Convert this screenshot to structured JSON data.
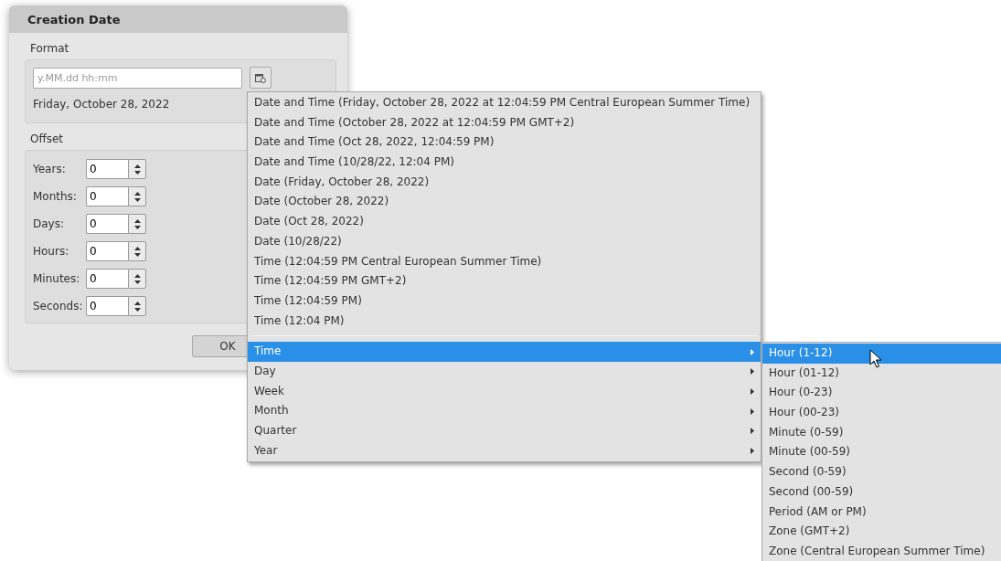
{
  "dialog": {
    "title": "Creation Date",
    "format": {
      "label": "Format",
      "placeholder": "y.MM.dd hh:mm",
      "preview": "Friday, October 28, 2022"
    },
    "offset": {
      "label": "Offset",
      "fields": [
        {
          "label": "Years:",
          "value": "0"
        },
        {
          "label": "Months:",
          "value": "0"
        },
        {
          "label": "Days:",
          "value": "0"
        },
        {
          "label": "Hours:",
          "value": "0"
        },
        {
          "label": "Minutes:",
          "value": "0"
        },
        {
          "label": "Seconds:",
          "value": "0"
        }
      ]
    },
    "buttons": [
      "OK"
    ]
  },
  "menu": {
    "items": [
      {
        "kind": "item",
        "label": "Date and Time (Friday, October 28, 2022 at 12:04:59 PM Central European Summer Time)",
        "selected": false
      },
      {
        "kind": "item",
        "label": "Date and Time (October 28, 2022 at 12:04:59 PM GMT+2)",
        "selected": false
      },
      {
        "kind": "item",
        "label": "Date and Time (Oct 28, 2022, 12:04:59 PM)",
        "selected": false
      },
      {
        "kind": "item",
        "label": "Date and Time (10/28/22, 12:04 PM)",
        "selected": false
      },
      {
        "kind": "item",
        "label": "Date (Friday, October 28, 2022)",
        "selected": false
      },
      {
        "kind": "item",
        "label": "Date (October 28, 2022)",
        "selected": false
      },
      {
        "kind": "item",
        "label": "Date (Oct 28, 2022)",
        "selected": false
      },
      {
        "kind": "item",
        "label": "Date (10/28/22)",
        "selected": false
      },
      {
        "kind": "item",
        "label": "Time (12:04:59 PM Central European Summer Time)",
        "selected": false
      },
      {
        "kind": "item",
        "label": "Time (12:04:59 PM GMT+2)",
        "selected": false
      },
      {
        "kind": "item",
        "label": "Time (12:04:59 PM)",
        "selected": false
      },
      {
        "kind": "item",
        "label": "Time (12:04 PM)",
        "selected": false
      },
      {
        "kind": "separator"
      },
      {
        "kind": "submenu",
        "label": "Time",
        "selected": true
      },
      {
        "kind": "submenu",
        "label": "Day",
        "selected": false
      },
      {
        "kind": "submenu",
        "label": "Week",
        "selected": false
      },
      {
        "kind": "submenu",
        "label": "Month",
        "selected": false
      },
      {
        "kind": "submenu",
        "label": "Quarter",
        "selected": false
      },
      {
        "kind": "submenu",
        "label": "Year",
        "selected": false
      }
    ]
  },
  "submenu": {
    "items": [
      {
        "label": "Hour (1-12)",
        "selected": true
      },
      {
        "label": "Hour (01-12)",
        "selected": false
      },
      {
        "label": "Hour (0-23)",
        "selected": false
      },
      {
        "label": "Hour (00-23)",
        "selected": false
      },
      {
        "label": "Minute (0-59)",
        "selected": false
      },
      {
        "label": "Minute (00-59)",
        "selected": false
      },
      {
        "label": "Second (0-59)",
        "selected": false
      },
      {
        "label": "Second (00-59)",
        "selected": false
      },
      {
        "label": "Period (AM or PM)",
        "selected": false
      },
      {
        "label": "Zone (GMT+2)",
        "selected": false
      },
      {
        "label": "Zone (Central European Summer Time)",
        "selected": false
      }
    ]
  }
}
